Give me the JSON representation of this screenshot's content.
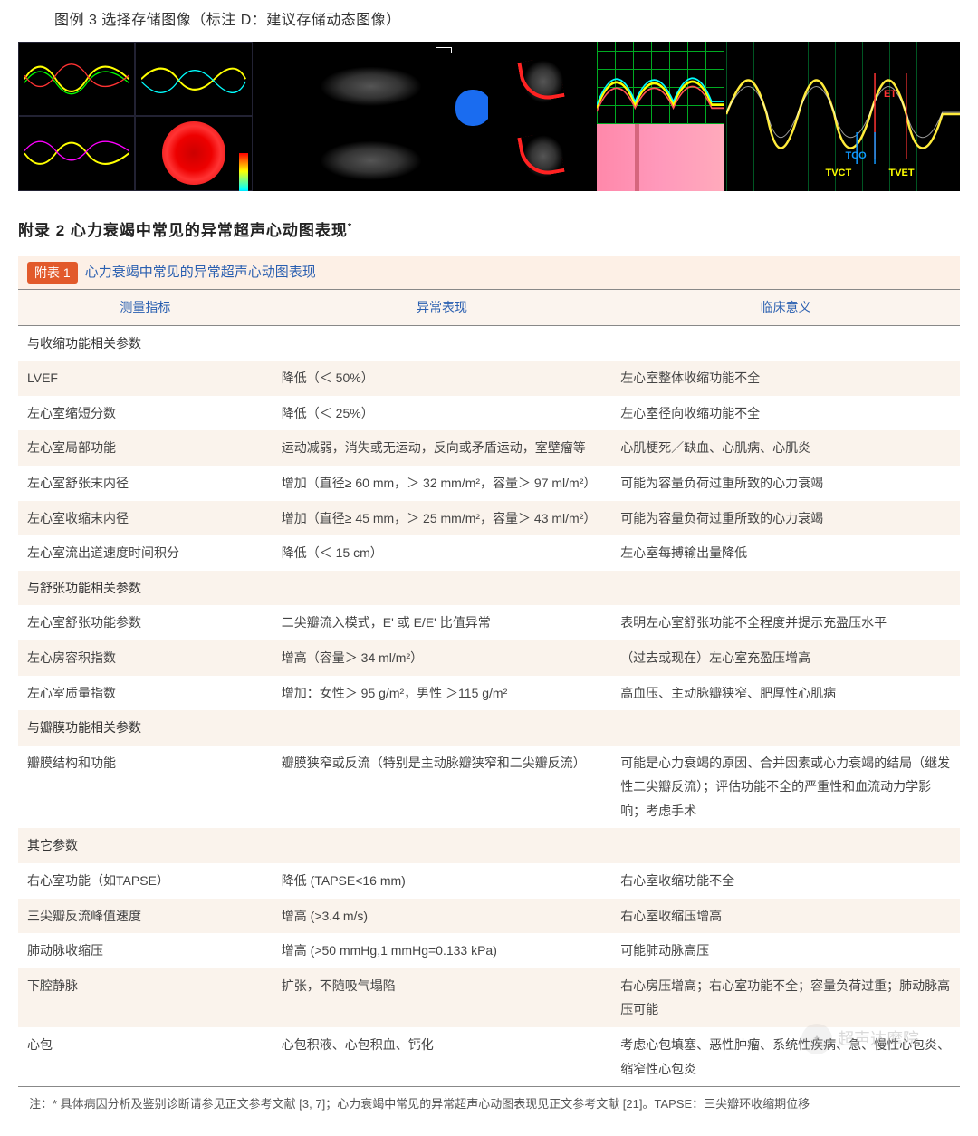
{
  "figure": {
    "caption": "图例 3  选择存储图像（标注 D：建议存储动态图像）",
    "d_marker": "D",
    "panel4_labels": {
      "et": "ET",
      "tco": "TCO",
      "tvct": "TVCT",
      "tvet": "TVET"
    }
  },
  "appendix": {
    "title": "附录 2  心力衰竭中常见的异常超声心动图表现",
    "sup": "*"
  },
  "table": {
    "badge": "附表 1",
    "title": "心力衰竭中常见的异常超声心动图表现",
    "headers": [
      "测量指标",
      "异常表现",
      "临床意义"
    ],
    "sections": [
      {
        "label": "与收缩功能相关参数",
        "rows": [
          {
            "c1": "LVEF",
            "c2": "降低（＜ 50%）",
            "c3": "左心室整体收缩功能不全"
          },
          {
            "c1": "左心室缩短分数",
            "c2": "降低（＜ 25%）",
            "c3": "左心室径向收缩功能不全"
          },
          {
            "c1": "左心室局部功能",
            "c2": "运动减弱，消失或无运动，反向或矛盾运动，室壁瘤等",
            "c3": "心肌梗死／缺血、心肌病、心肌炎"
          },
          {
            "c1": "左心室舒张末内径",
            "c2": "增加（直径≥ 60 mm，＞ 32 mm/m²，容量＞ 97 ml/m²）",
            "c3": "可能为容量负荷过重所致的心力衰竭"
          },
          {
            "c1": "左心室收缩末内径",
            "c2": "增加（直径≥ 45 mm，＞ 25 mm/m²，容量＞ 43 ml/m²）",
            "c3": "可能为容量负荷过重所致的心力衰竭"
          },
          {
            "c1": "左心室流出道速度时间积分",
            "c2": "降低（＜ 15 cm）",
            "c3": "左心室每搏输出量降低"
          }
        ]
      },
      {
        "label": "与舒张功能相关参数",
        "rows": [
          {
            "c1": "左心室舒张功能参数",
            "c2": "二尖瓣流入模式，E' 或 E/E' 比值异常",
            "c3": "表明左心室舒张功能不全程度并提示充盈压水平"
          },
          {
            "c1": "左心房容积指数",
            "c2": "增高（容量＞ 34 ml/m²）",
            "c3": "（过去或现在）左心室充盈压增高"
          },
          {
            "c1": "左心室质量指数",
            "c2": "增加：女性＞ 95 g/m²，男性 ＞115 g/m²",
            "c3": "高血压、主动脉瓣狭窄、肥厚性心肌病"
          }
        ]
      },
      {
        "label": "与瓣膜功能相关参数",
        "rows": [
          {
            "c1": "瓣膜结构和功能",
            "c2": "瓣膜狭窄或反流（特别是主动脉瓣狭窄和二尖瓣反流）",
            "c3": "可能是心力衰竭的原因、合并因素或心力衰竭的结局（继发性二尖瓣反流）；评估功能不全的严重性和血流动力学影响；考虑手术"
          }
        ]
      },
      {
        "label": "其它参数",
        "rows": [
          {
            "c1": "右心室功能（如TAPSE）",
            "c2": "降低 (TAPSE<16 mm)",
            "c3": "右心室收缩功能不全"
          },
          {
            "c1": "三尖瓣反流峰值速度",
            "c2": "增高 (>3.4 m/s)",
            "c3": "右心室收缩压增高"
          },
          {
            "c1": "肺动脉收缩压",
            "c2": "增高 (>50 mmHg,1 mmHg=0.133 kPa)",
            "c3": "可能肺动脉高压"
          },
          {
            "c1": "下腔静脉",
            "c2": "扩张，不随吸气塌陷",
            "c3": "右心房压增高；右心室功能不全；容量负荷过重；肺动脉高压可能"
          },
          {
            "c1": "心包",
            "c2": "心包积液、心包积血、钙化",
            "c3": "考虑心包填塞、恶性肿瘤、系统性疾病、急、慢性心包炎、缩窄性心包炎"
          }
        ]
      }
    ],
    "footnote": "注：* 具体病因分析及鉴别诊断请参见正文参考文献 [3, 7]；心力衰竭中常见的异常超声心动图表现见正文参考文献 [21]。TAPSE：三尖瓣环收缩期位移"
  },
  "watermark": "超声达摩院"
}
